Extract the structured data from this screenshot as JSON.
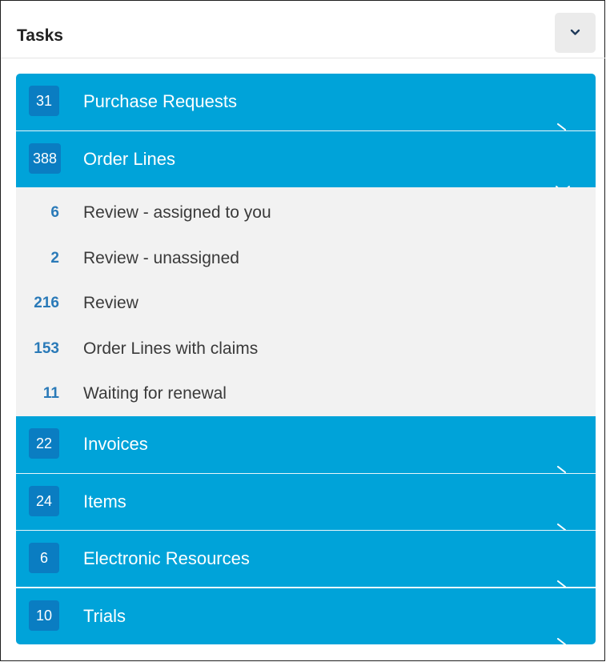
{
  "header": {
    "title": "Tasks",
    "collapse_icon": "chevron-down-icon"
  },
  "groups": [
    {
      "count": "31",
      "label": "Purchase Requests",
      "expanded": false
    },
    {
      "count": "388",
      "label": "Order Lines",
      "expanded": true,
      "subitems": [
        {
          "count": "6",
          "label": "Review - assigned to you"
        },
        {
          "count": "2",
          "label": "Review - unassigned"
        },
        {
          "count": "216",
          "label": "Review"
        },
        {
          "count": "153",
          "label": "Order Lines with claims"
        },
        {
          "count": "11",
          "label": "Waiting for renewal"
        }
      ]
    },
    {
      "count": "22",
      "label": "Invoices",
      "expanded": false
    },
    {
      "count": "24",
      "label": "Items",
      "expanded": false
    },
    {
      "count": "6",
      "label": "Electronic Resources",
      "expanded": false
    },
    {
      "count": "10",
      "label": "Trials",
      "expanded": false
    }
  ],
  "colors": {
    "accent": "#00a3d9",
    "badge": "#0a7dc2",
    "subitem_count": "#2a7ab8",
    "subitem_background": "#f2f2f2"
  }
}
